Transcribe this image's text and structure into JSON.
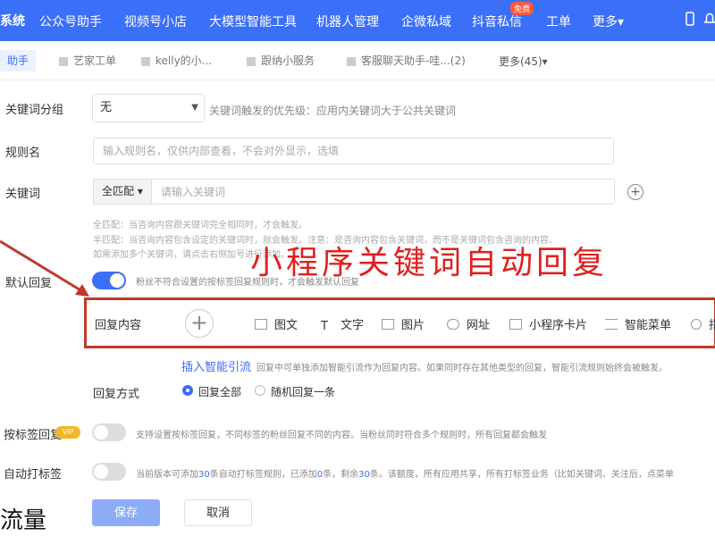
{
  "topnav": {
    "brand": "系统",
    "items": [
      "公众号助手",
      "视频号小店",
      "大模型智能工具",
      "机器人管理",
      "企微私域",
      "抖音私信",
      "工单",
      "更多▾"
    ],
    "badge": "免费"
  },
  "tabs": {
    "items": [
      "助手",
      "艺家工单",
      "kelly的小...",
      "跟纳小服务",
      "客服聊天助手-哇...(2)"
    ],
    "more": "更多(45)▾"
  },
  "form": {
    "group_label": "关键词分组",
    "group_value": "无",
    "group_hint": "关键词触发的优先级：应用内关键词大于公共关键词",
    "rule_label": "规则名",
    "rule_placeholder": "输入规则名，仅供内部查看，不会对外显示，选填",
    "keyword_label": "关键词",
    "keyword_match": "全匹配",
    "keyword_placeholder": "请输入关键词",
    "note_1": "全匹配：当咨询内容跟关键词完全相同时，才会触发。",
    "note_2": "半匹配：当咨询内容包含设定的关键词时，就会触发。注意：是咨询内容包含关键词，而不是关键词包含咨询的内容。",
    "note_3": "如需添加多个关键词，请点击右侧加号进行添加。",
    "default_label": "默认回复",
    "default_hint": "粉丝不符合设置的按标签回复规则时，才会触发默认回复",
    "reply_content_label": "回复内容",
    "reply_types": [
      "图文",
      "文字",
      "图片",
      "网址",
      "小程序卡片",
      "智能菜单",
      "指"
    ],
    "smart_link": "插入智能引流",
    "smart_hint": "回复中可单独添加智能引流作为回复内容。如果同时存在其他类型的回复，智能引流规则始终会被触发。",
    "reply_mode_label": "回复方式",
    "reply_all": "回复全部",
    "reply_random": "随机回复一条",
    "tag_reply_label": "按标签回复",
    "tag_vip": "VIP",
    "tag_hint": "支持设置按标签回复，不同标签的粉丝回复不同的内容。当粉丝同时符合多个规则时，所有回复都会触发",
    "auto_tag_label": "自动打标签",
    "auto_tag_hint_a": "当前版本可添加",
    "auto_tag_n1": "30",
    "auto_tag_hint_b": "条自动打标签规则，已添加",
    "auto_tag_n2": "0",
    "auto_tag_hint_c": "条，剩余",
    "auto_tag_n3": "30",
    "auto_tag_hint_d": "条。该额度，所有应用共享，所有打标签业务（比如关键词、关注后，点菜单",
    "save": "保存",
    "cancel": "取消"
  },
  "overlay": {
    "title": "小程序关键词自动回复",
    "corner": "流量"
  },
  "colors": {
    "accent": "#3a6ff7",
    "highlight": "#c0392b",
    "overlay_text": "#e02020"
  }
}
